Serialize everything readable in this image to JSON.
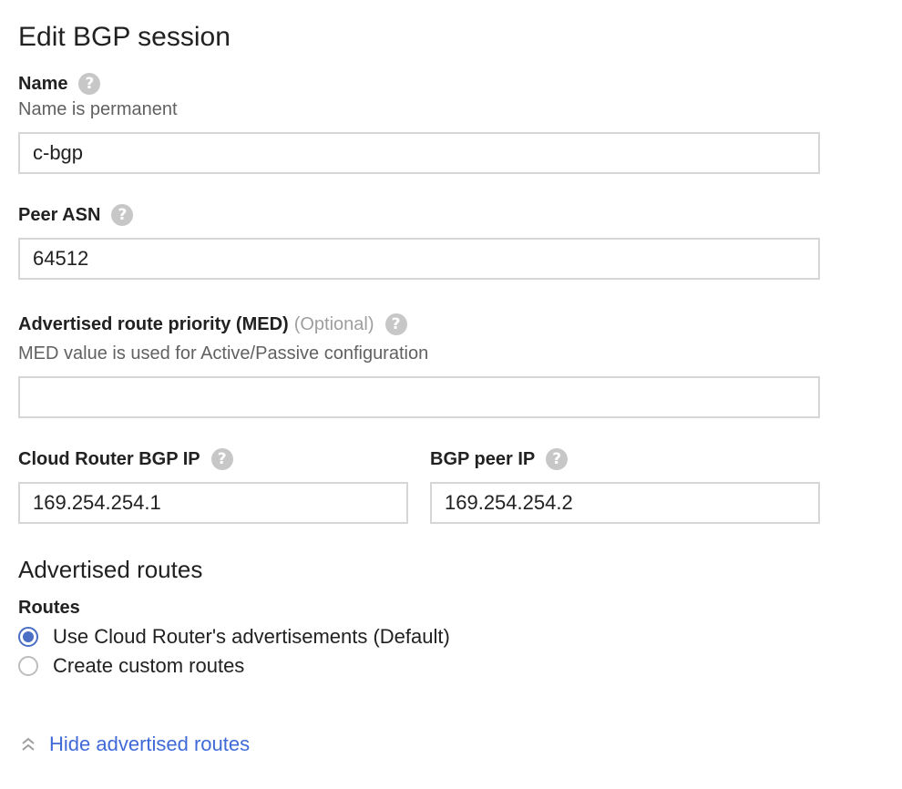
{
  "form": {
    "title": "Edit BGP session",
    "name": {
      "label": "Name",
      "hint": "Name is permanent",
      "value": "c-bgp"
    },
    "peer_asn": {
      "label": "Peer ASN",
      "value": "64512"
    },
    "med": {
      "label": "Advertised route priority (MED)",
      "optional": "(Optional)",
      "hint": "MED value is used for Active/Passive configuration",
      "value": ""
    },
    "cloud_router_ip": {
      "label": "Cloud Router BGP IP",
      "value": "169.254.254.1"
    },
    "peer_ip": {
      "label": "BGP peer IP",
      "value": "169.254.254.2"
    }
  },
  "advertised_routes": {
    "title": "Advertised routes",
    "routes_label": "Routes",
    "options": [
      {
        "label": "Use Cloud Router's advertisements (Default)",
        "selected": true
      },
      {
        "label": "Create custom routes",
        "selected": false
      }
    ],
    "toggle_label": "Hide advertised routes"
  },
  "icons": {
    "help": "help-icon",
    "toggle": "chevron-up-icon"
  },
  "colors": {
    "accent": "#4a6fc4",
    "link": "#3f6ad8"
  }
}
